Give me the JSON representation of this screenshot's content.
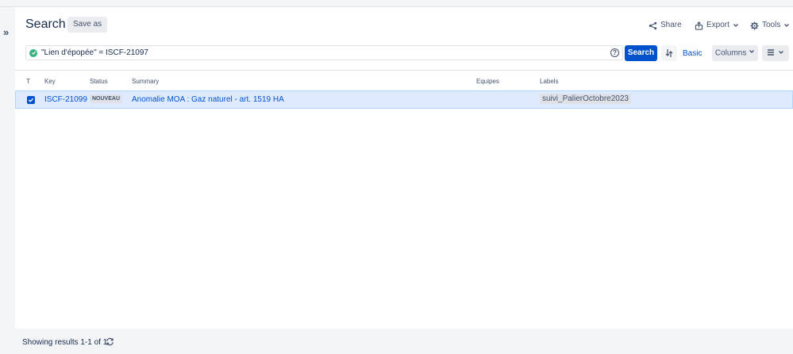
{
  "header": {
    "title": "Search",
    "save_as": "Save as",
    "share": "Share",
    "export": "Export",
    "tools": "Tools"
  },
  "query": {
    "jql": "\"Lien d'épopée\" = ISCF-21097",
    "search_label": "Search",
    "basic_label": "Basic",
    "columns_label": "Columns"
  },
  "table": {
    "headers": {
      "type": "T",
      "key": "Key",
      "status": "Status",
      "summary": "Summary",
      "equipes": "Equipes",
      "labels": "Labels"
    },
    "rows": [
      {
        "checked": true,
        "key": "ISCF-21099",
        "status": "NOUVEAU",
        "summary": "Anomalie MOA : Gaz naturel - art. 1519 HA",
        "equipes": "",
        "label": "suivi_PalierOctobre2023"
      }
    ]
  },
  "footer": {
    "results": "Showing results 1-1 of 1"
  },
  "colors": {
    "primary": "#0052cc",
    "valid": "#36b37e",
    "selected_row": "#deebff"
  }
}
